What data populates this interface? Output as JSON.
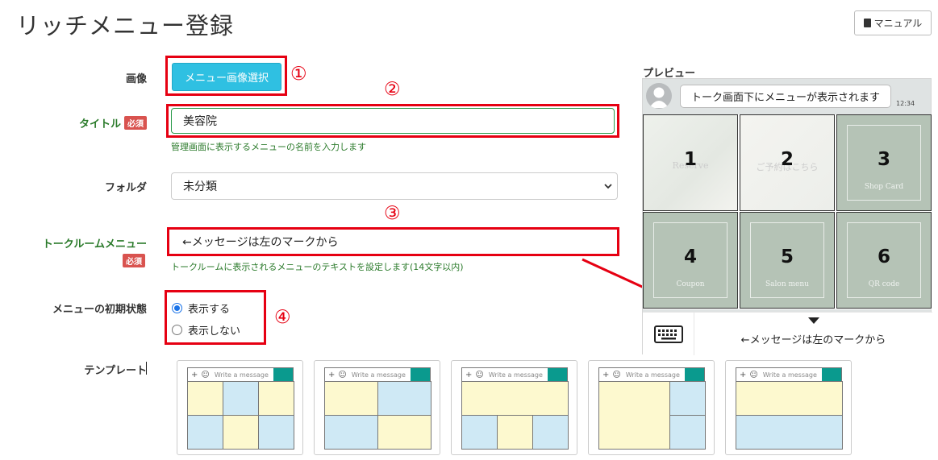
{
  "page": {
    "title": "リッチメニュー登録",
    "manual_button": "マニュアル"
  },
  "form": {
    "image": {
      "label": "画像",
      "button": "メニュー画像選択",
      "marker": "①"
    },
    "title": {
      "label": "タイトル",
      "required": "必須",
      "value": "美容院",
      "help": "管理画面に表示するメニューの名前を入力します",
      "marker": "②"
    },
    "folder": {
      "label": "フォルダ",
      "selected": "未分類"
    },
    "talkroom_menu": {
      "label": "トークルームメニュー",
      "required": "必須",
      "value": "←メッセージは左のマークから",
      "help": "トークルームに表示されるメニューのテキストを設定します(14文字以内)",
      "marker": "③"
    },
    "initial_state": {
      "label": "メニューの初期状態",
      "options": [
        "表示する",
        "表示しない"
      ],
      "selected_index": 0,
      "marker": "④"
    },
    "template": {
      "label": "テンプレート",
      "input_placeholder": "Write a message",
      "plus": "+",
      "smiley": "☺"
    }
  },
  "preview": {
    "title": "プレビュー",
    "bubble_text": "トーク画面下にメニューが表示されます",
    "time": "12:34",
    "cells": [
      {
        "number": "1",
        "text": "Reserve"
      },
      {
        "number": "2",
        "text": "ご予約はこちら"
      },
      {
        "number": "3",
        "text": "Shop Card"
      },
      {
        "number": "4",
        "text": "Coupon"
      },
      {
        "number": "5",
        "text": "Salon menu"
      },
      {
        "number": "6",
        "text": "QR code"
      }
    ],
    "menu_toggle_text": "←メッセージは左のマークから"
  },
  "colors": {
    "accent_red": "#e60012",
    "button_cyan": "#2fc0e2",
    "help_green": "#2a7a2a",
    "template_header": "#0a9a8e",
    "template_yellow": "#fdf9cf",
    "template_blue": "#cfe9f5"
  }
}
